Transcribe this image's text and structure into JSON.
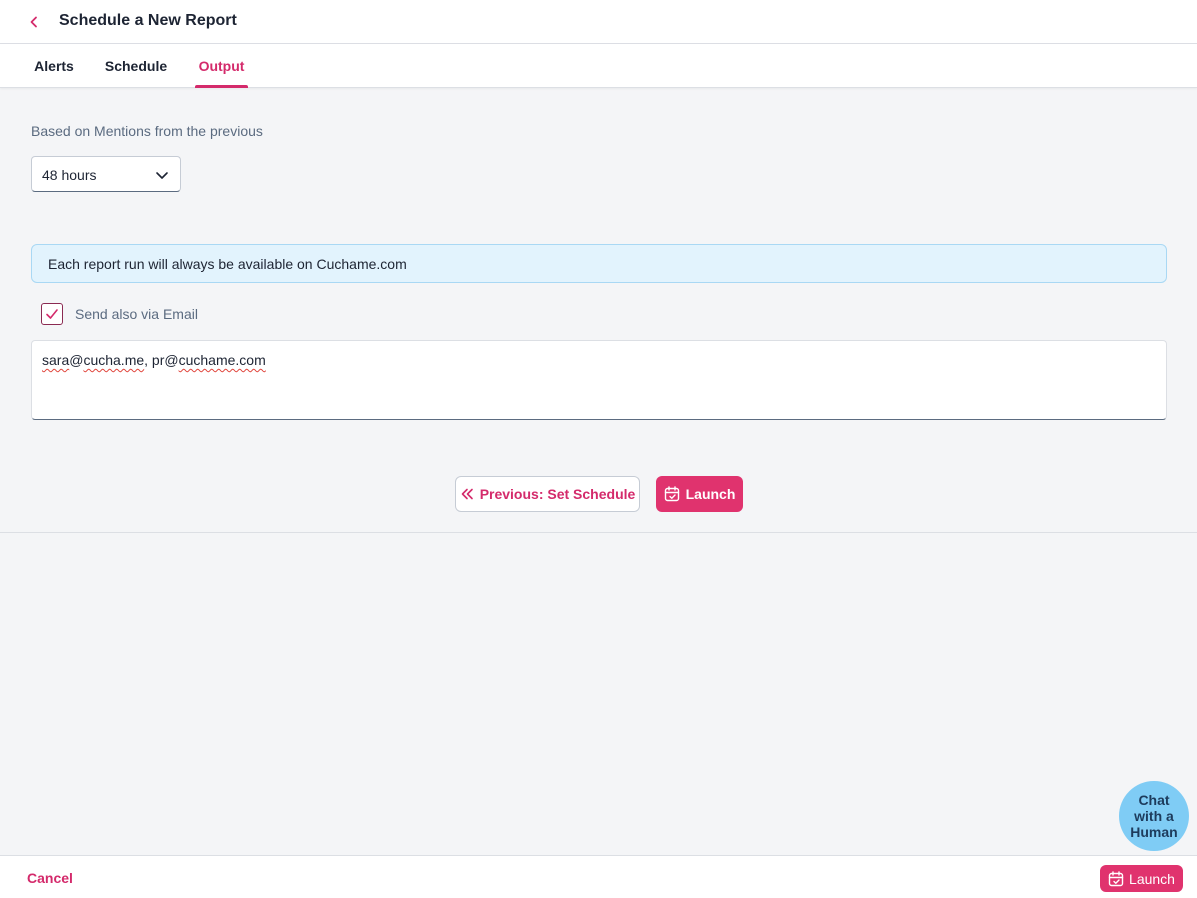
{
  "header": {
    "title": "Schedule a New Report"
  },
  "tabs": [
    {
      "label": "Alerts"
    },
    {
      "label": "Schedule"
    },
    {
      "label": "Output"
    }
  ],
  "output": {
    "based_on_label": "Based on Mentions from the previous",
    "period_select": {
      "value": "48 hours"
    },
    "info_banner": "Each report run will always be available on Cuchame.com",
    "email_checkbox": {
      "label": "Send also via Email",
      "checked": true
    },
    "email_field": {
      "value": "sara@cucha.me, pr@cuchame.com",
      "parts": [
        "sara",
        "@",
        "cucha.me",
        ", pr@",
        "cuchame.com"
      ]
    },
    "prev_button": "Previous: Set Schedule",
    "launch_button": "Launch"
  },
  "footer": {
    "cancel": "Cancel",
    "launch": "Launch"
  },
  "chat": {
    "label": "Chat with a Human"
  },
  "colors": {
    "accent": "#d42a6b",
    "launch_bg": "#e0336e",
    "info_bg": "#e2f3fd",
    "chat_bg": "#7fccf5"
  },
  "icons": {
    "back": "chevron-left-icon",
    "select": "chevron-down-icon",
    "checkbox": "check-icon",
    "prev": "double-chevron-left-icon",
    "launch": "calendar-check-icon"
  }
}
